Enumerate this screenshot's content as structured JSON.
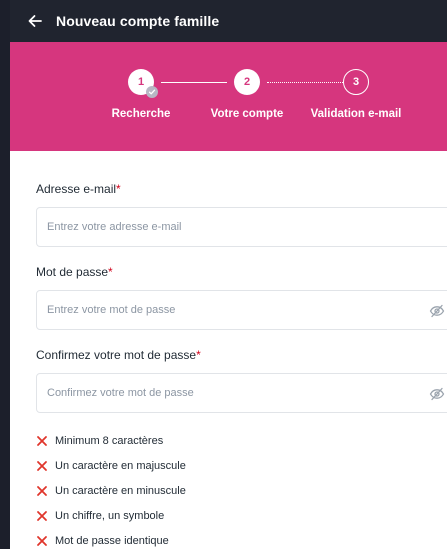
{
  "header": {
    "title": "Nouveau compte famille",
    "back_icon": "arrow-left-icon"
  },
  "stepper": {
    "accent": "#d6367e",
    "steps": [
      {
        "number": "1",
        "label": "Recherche",
        "state": "done"
      },
      {
        "number": "2",
        "label": "Votre compte",
        "state": "active"
      },
      {
        "number": "3",
        "label": "Validation e-mail",
        "state": "todo"
      }
    ]
  },
  "form": {
    "email": {
      "label": "Adresse e-mail",
      "required_mark": "*",
      "placeholder": "Entrez votre adresse e-mail",
      "value": ""
    },
    "password": {
      "label": "Mot de passe",
      "required_mark": "*",
      "placeholder": "Entrez votre mot de passe",
      "value": "",
      "toggle_icon": "eye-slash-icon"
    },
    "confirm": {
      "label": "Confirmez votre mot de passe",
      "required_mark": "*",
      "placeholder": "Confirmez votre mot de passe",
      "value": "",
      "toggle_icon": "eye-slash-icon"
    }
  },
  "password_rules": {
    "status_icon": "cross-icon",
    "status_color": "#e0352b",
    "items": [
      "Minimum 8 caractères",
      "Un caractère en majuscule",
      "Un caractère en minuscule",
      "Un chiffre, un symbole",
      "Mot de passe identique"
    ]
  }
}
